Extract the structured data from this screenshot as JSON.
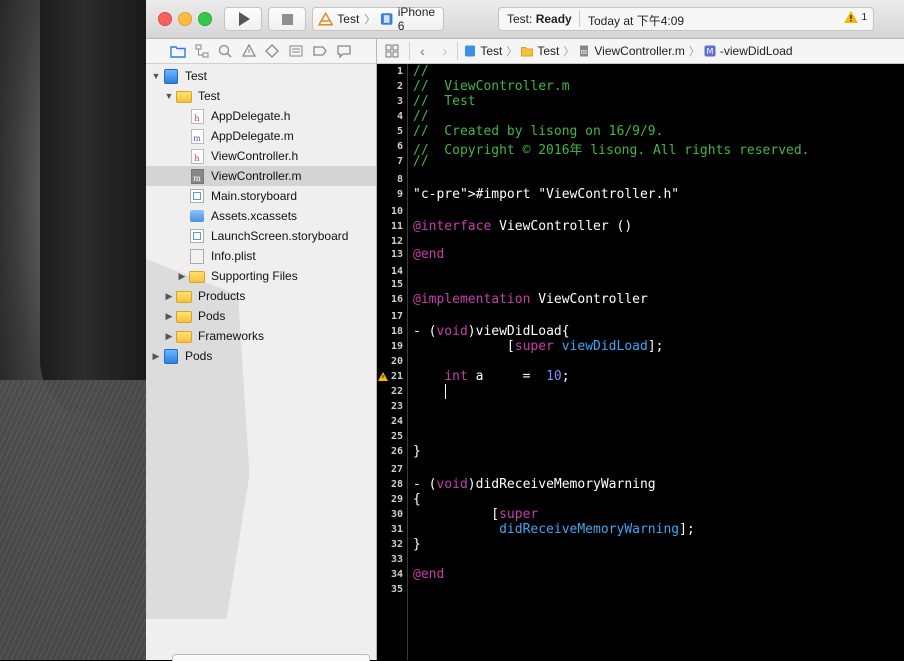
{
  "toolbar": {
    "scheme_target": "Test",
    "scheme_device": "iPhone 6",
    "status_project": "Test:",
    "status_state": "Ready",
    "status_time": "Today at 下午4:09",
    "warning_count": "1"
  },
  "navigator": {
    "items": [
      {
        "label": "Test",
        "type": "project",
        "level": 0,
        "disclosure": "open"
      },
      {
        "label": "Test",
        "type": "folder",
        "level": 1,
        "disclosure": "open"
      },
      {
        "label": "AppDelegate.h",
        "type": "h",
        "level": 2
      },
      {
        "label": "AppDelegate.m",
        "type": "m",
        "level": 2
      },
      {
        "label": "ViewController.h",
        "type": "h",
        "level": 2
      },
      {
        "label": "ViewController.m",
        "type": "m",
        "level": 2,
        "selected": true
      },
      {
        "label": "Main.storyboard",
        "type": "storyboard",
        "level": 2
      },
      {
        "label": "Assets.xcassets",
        "type": "xcassets",
        "level": 2
      },
      {
        "label": "LaunchScreen.storyboard",
        "type": "storyboard",
        "level": 2
      },
      {
        "label": "Info.plist",
        "type": "plist",
        "level": 2
      },
      {
        "label": "Supporting Files",
        "type": "folder",
        "level": 2,
        "disclosure": "closed"
      },
      {
        "label": "Products",
        "type": "folder",
        "level": 1,
        "disclosure": "closed"
      },
      {
        "label": "Pods",
        "type": "folder",
        "level": 1,
        "disclosure": "closed"
      },
      {
        "label": "Frameworks",
        "type": "folder",
        "level": 1,
        "disclosure": "closed"
      },
      {
        "label": "Pods",
        "type": "project",
        "level": 0,
        "disclosure": "closed"
      }
    ]
  },
  "jumpbar": {
    "crumbs": [
      "Test",
      "Test",
      "ViewController.m",
      "-viewDidLoad"
    ]
  },
  "editor": {
    "warning_line": "21",
    "lines": [
      {
        "n": "1",
        "t": "//"
      },
      {
        "n": "2",
        "t": "//  ViewController.m"
      },
      {
        "n": "3",
        "t": "//  Test"
      },
      {
        "n": "4",
        "t": "//"
      },
      {
        "n": "5",
        "t": "//  Created by lisong on 16/9/9."
      },
      {
        "n": "6",
        "t": "//  Copyright © 2016年 lisong. All rights reserved."
      },
      {
        "n": "7",
        "t": "//"
      },
      {
        "n": "8",
        "t": ""
      },
      {
        "n": "9",
        "t": "#import \"ViewController.h\""
      },
      {
        "n": "10",
        "t": ""
      },
      {
        "n": "11",
        "t": "@interface ViewController ()"
      },
      {
        "n": "12",
        "t": ""
      },
      {
        "n": "13",
        "t": "@end"
      },
      {
        "n": "14",
        "t": ""
      },
      {
        "n": "15",
        "t": ""
      },
      {
        "n": "16",
        "t": "@implementation ViewController"
      },
      {
        "n": "17",
        "t": ""
      },
      {
        "n": "18",
        "t": "- (void)viewDidLoad{"
      },
      {
        "n": "19",
        "t": "            [super viewDidLoad];"
      },
      {
        "n": "20",
        "t": ""
      },
      {
        "n": "21",
        "t": "    int a     =  10;"
      },
      {
        "n": "22",
        "t": ""
      },
      {
        "n": "23",
        "t": ""
      },
      {
        "n": "24",
        "t": ""
      },
      {
        "n": "25",
        "t": ""
      },
      {
        "n": "26",
        "t": "}"
      },
      {
        "n": "27",
        "t": ""
      },
      {
        "n": "28",
        "t": "- (void)didReceiveMemoryWarning"
      },
      {
        "n": "29",
        "t": "{"
      },
      {
        "n": "30",
        "t": "          [super"
      },
      {
        "n": "31",
        "t": "           didReceiveMemoryWarning];"
      },
      {
        "n": "32",
        "t": "}"
      },
      {
        "n": "33",
        "t": ""
      },
      {
        "n": "34",
        "t": "@end"
      },
      {
        "n": "35",
        "t": ""
      }
    ]
  }
}
